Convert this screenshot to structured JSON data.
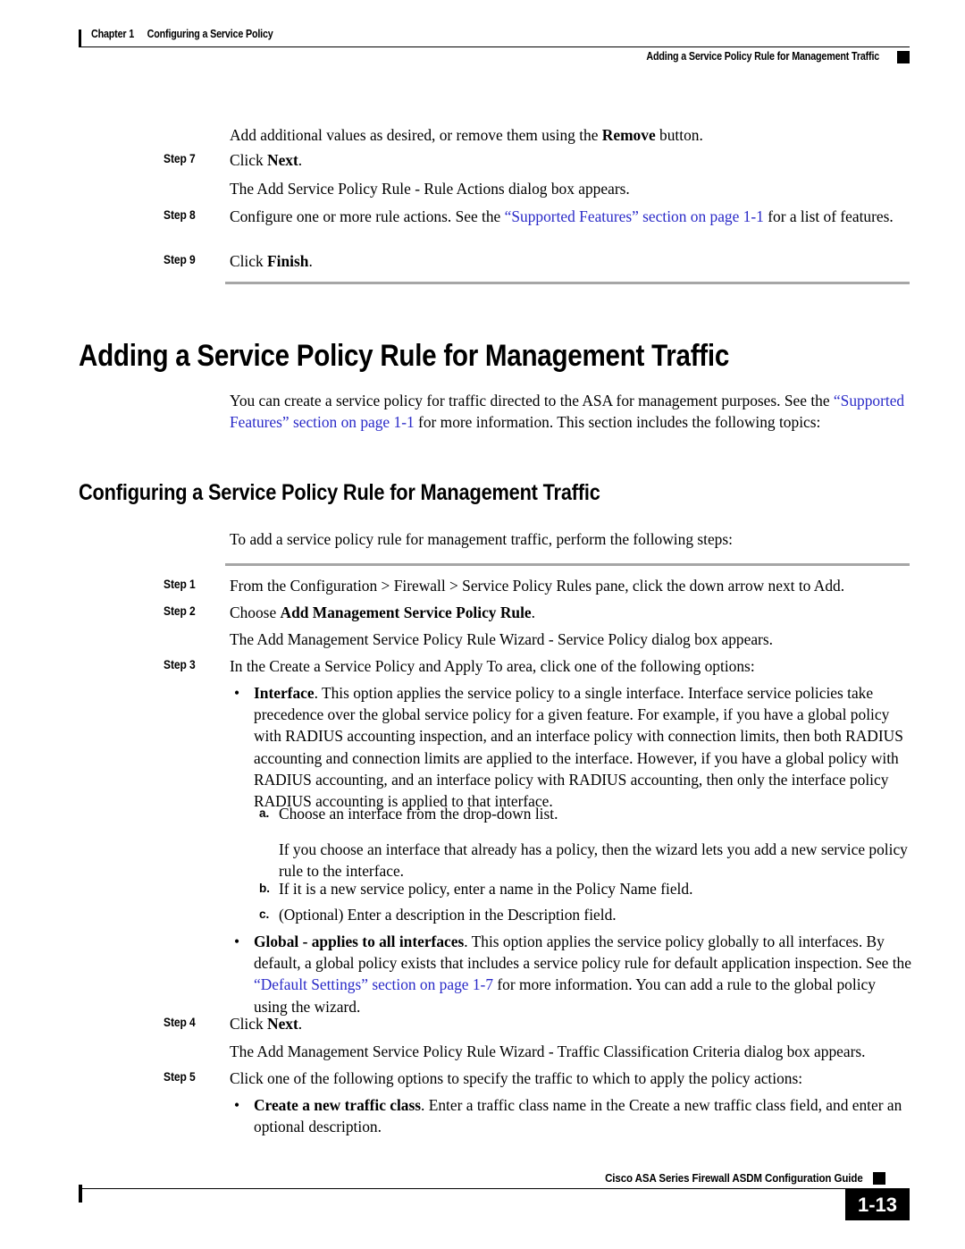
{
  "header": {
    "chapter_number": "Chapter 1",
    "chapter_title": "Configuring a Service Policy",
    "section_title": "Adding a Service Policy Rule for Management Traffic"
  },
  "footer": {
    "guide_title": "Cisco ASA Series Firewall ASDM Configuration Guide",
    "page_number": "1-13"
  },
  "colors": {
    "link": "#2a2ac8",
    "rule_gray": "#a6a6a6",
    "text": "#000000"
  },
  "content": {
    "intro_note": {
      "text_before": "Add additional values as desired, or remove them using the ",
      "bold": "Remove",
      "text_after": " button."
    },
    "step7": {
      "label": "Step 7",
      "text_before": "Click ",
      "bold": "Next",
      "text_after": "."
    },
    "step7_result": "The Add Service Policy Rule - Rule Actions dialog box appears.",
    "step8": {
      "label": "Step 8",
      "text_before": "Configure one or more rule actions. See the ",
      "link": "“Supported Features” section on page 1-1",
      "text_after": " for a list of features."
    },
    "step9": {
      "label": "Step 9",
      "text_before": "Click ",
      "bold": "Finish",
      "text_after": "."
    },
    "heading1": "Adding a Service Policy Rule for Management Traffic",
    "heading1_para": {
      "text_before": "You can create a service policy for traffic directed to the ASA for management purposes. See the ",
      "link": "“Supported Features” section on page 1-1",
      "text_after": " for more information. This section includes the following topics:"
    },
    "heading2": "Configuring a Service Policy Rule for Management Traffic",
    "heading2_para": "To add a service policy rule for management traffic, perform the following steps:",
    "step1": {
      "label": "Step 1",
      "text": "From the Configuration > Firewall > Service Policy Rules pane, click the down arrow next to Add."
    },
    "step2": {
      "label": "Step 2",
      "text_before": "Choose ",
      "bold": "Add Management Service Policy Rule",
      "text_after": "."
    },
    "step2_result": "The Add Management Service Policy Rule Wizard - Service Policy dialog box appears.",
    "step3": {
      "label": "Step 3",
      "text": "In the Create a Service Policy and Apply To area, click one of the following options:"
    },
    "bullet_interface": {
      "marker": "•",
      "bold": "Interface",
      "text": ". This option applies the service policy to a single interface. Interface service policies take precedence over the global service policy for a given feature. For example, if you have a global policy with RADIUS accounting inspection, and an interface policy with connection limits, then both RADIUS accounting and connection limits are applied to the interface. However, if you have a global policy with RADIUS accounting, and an interface policy with RADIUS accounting, then only the interface policy RADIUS accounting is applied to that interface."
    },
    "sub_a": {
      "marker": "a.",
      "text": "Choose an interface from the drop-down list."
    },
    "sub_a_cont": "If you choose an interface that already has a policy, then the wizard lets you add a new service policy rule to the interface.",
    "sub_b": {
      "marker": "b.",
      "text": "If it is a new service policy, enter a name in the Policy Name field."
    },
    "sub_c": {
      "marker": "c.",
      "text": "(Optional) Enter a description in the Description field."
    },
    "bullet_global": {
      "marker": "•",
      "bold": "Global - applies to all interfaces",
      "text_before": ". This option applies the service policy globally to all interfaces. By default, a global policy exists that includes a service policy rule for default application inspection. See the ",
      "link": "“Default Settings” section on page 1-7",
      "text_after": " for more information. You can add a rule to the global policy using the wizard."
    },
    "step4": {
      "label": "Step 4",
      "text_before": "Click ",
      "bold": "Next",
      "text_after": "."
    },
    "step4_result": "The Add Management Service Policy Rule Wizard - Traffic Classification Criteria dialog box appears.",
    "step5": {
      "label": "Step 5",
      "text": "Click one of the following options to specify the traffic to which to apply the policy actions:"
    },
    "bullet_create_class": {
      "marker": "•",
      "bold": "Create a new traffic class",
      "text": ". Enter a traffic class name in the Create a new traffic class field, and enter an optional description."
    }
  }
}
